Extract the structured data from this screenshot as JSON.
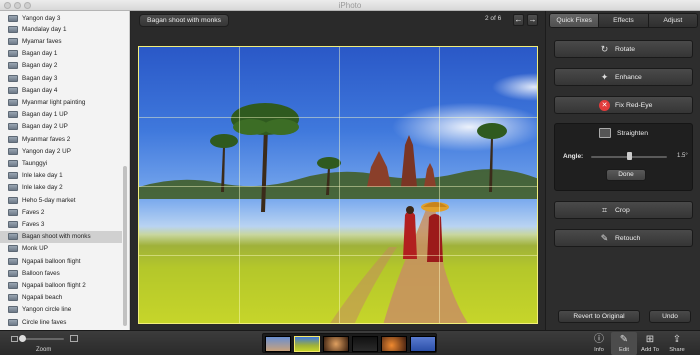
{
  "app": {
    "title": "iPhoto"
  },
  "sidebar": {
    "items": [
      {
        "label": "Yangon day 3",
        "selected": false
      },
      {
        "label": "Mandalay day 1",
        "selected": false
      },
      {
        "label": "Myamar faves",
        "selected": false
      },
      {
        "label": "Bagan day 1",
        "selected": false
      },
      {
        "label": "Bagan day 2",
        "selected": false
      },
      {
        "label": "Bagan day 3",
        "selected": false
      },
      {
        "label": "Bagan day 4",
        "selected": false
      },
      {
        "label": "Myanmar light painting",
        "selected": false
      },
      {
        "label": "Bagan day 1 UP",
        "selected": false
      },
      {
        "label": "Bagan day 2 UP",
        "selected": false
      },
      {
        "label": "Myanmar faves 2",
        "selected": false
      },
      {
        "label": "Yangon day 2 UP",
        "selected": false
      },
      {
        "label": "Taunggyi",
        "selected": false
      },
      {
        "label": "Inle lake day 1",
        "selected": false
      },
      {
        "label": "Inle lake day 2",
        "selected": false
      },
      {
        "label": "Heho 5-day market",
        "selected": false
      },
      {
        "label": "Faves 2",
        "selected": false
      },
      {
        "label": "Faves 3",
        "selected": false
      },
      {
        "label": "Bagan shoot with monks",
        "selected": true
      },
      {
        "label": "Monk UP",
        "selected": false
      },
      {
        "label": "Ngapali balloon flight",
        "selected": false
      },
      {
        "label": "Balloon faves",
        "selected": false
      },
      {
        "label": "Ngapali balloon flight 2",
        "selected": false
      },
      {
        "label": "Ngapali beach",
        "selected": false
      },
      {
        "label": "Yangon circle line",
        "selected": false
      },
      {
        "label": "Circle line faves",
        "selected": false
      }
    ]
  },
  "viewer": {
    "album_title": "Bagan shoot with monks",
    "counter": "2 of 6",
    "prev_icon": "arrow-left-icon",
    "next_icon": "arrow-right-icon"
  },
  "panel": {
    "tabs": [
      {
        "label": "Quick Fixes",
        "active": true
      },
      {
        "label": "Effects",
        "active": false
      },
      {
        "label": "Adjust",
        "active": false
      }
    ],
    "tools": {
      "rotate": "Rotate",
      "enhance": "Enhance",
      "red_eye": "Fix Red-Eye",
      "crop": "Crop",
      "retouch": "Retouch"
    },
    "straighten": {
      "title": "Straighten",
      "angle_label": "Angle:",
      "angle_value": "1.5°",
      "done_label": "Done"
    },
    "revert_label": "Revert to Original",
    "undo_label": "Undo"
  },
  "toolbar": {
    "zoom_label": "Zoom",
    "info_label": "Info",
    "edit_label": "Edit",
    "add_to_label": "Add To",
    "share_label": "Share"
  },
  "colors": {
    "selection_outline": "#f4e96b",
    "sidebar_bg": "#f3f3f3",
    "red_eye_icon": "#e23b3b"
  }
}
